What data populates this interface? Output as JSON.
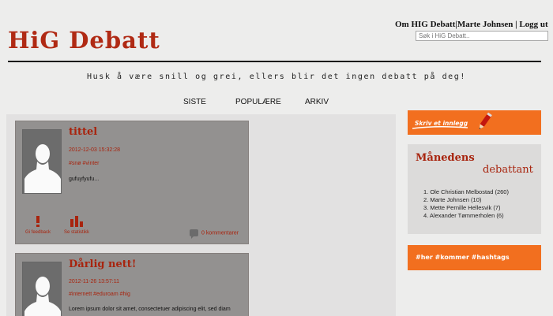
{
  "header": {
    "site_title": "HiG Debatt",
    "links": {
      "about": "Om HIG Debatt",
      "sep1": "|",
      "user": "Marte Johnsen",
      "sep2": " | ",
      "logout": "Logg ut"
    },
    "search_placeholder": "Søk i HiG Debatt.."
  },
  "tagline": "Husk å være snill og grei, ellers blir det ingen debatt på deg!",
  "nav": {
    "items": [
      "SISTE",
      "POPULÆRE",
      "ARKIV"
    ]
  },
  "posts": [
    {
      "title": "tittel",
      "date": "2012-12-03 15:32:28",
      "tags": "#snø #vinter",
      "excerpt": "gufuyfyufu...",
      "action_feedback": "Gi feedback",
      "action_stats": "Se statistikk",
      "comments": "0 kommentarer"
    },
    {
      "title": "Dårlig nett!",
      "date": "2012-11-26 13:57:11",
      "tags": "#internett #eduroam #hig",
      "excerpt": "Lorem ipsum dolor sit amet, consectetuer adipiscing elit, sed diam"
    }
  ],
  "sidebar": {
    "write_label": "Skriv et innlegg",
    "month_title_1": "Månedens",
    "month_title_2": "debattant",
    "month_list": [
      "1.  Ole Christian Melbostad (260)",
      "2.  Marte Johnsen (10)",
      "3.  Mette Pernille Hellesvik (7)",
      "4.  Alexander Tømmerholen (6)"
    ],
    "hashtags": "#her #kommer #hashtags"
  },
  "colors": {
    "accent_red": "#a8240e",
    "orange": "#f26f1f",
    "post_bg": "#939190"
  }
}
